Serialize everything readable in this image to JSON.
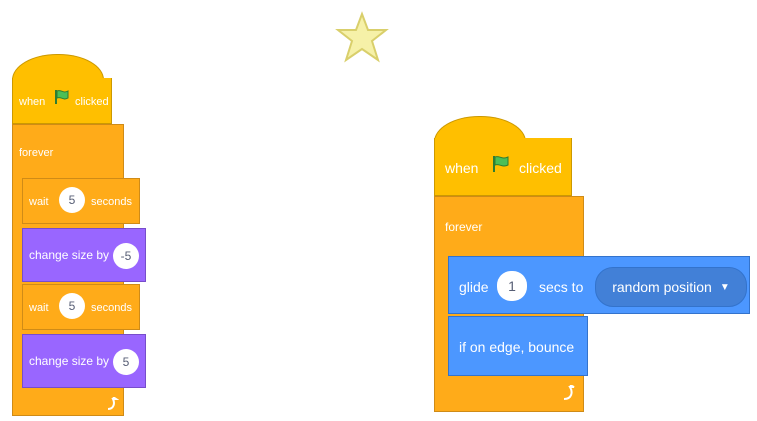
{
  "left_script": {
    "hat": {
      "prefix": "when",
      "suffix": "clicked"
    },
    "forever": "forever",
    "wait1": {
      "label": "wait",
      "value": "5",
      "unit": "seconds"
    },
    "change1": {
      "label": "change size by",
      "value": "-5"
    },
    "wait2": {
      "label": "wait",
      "value": "5",
      "unit": "seconds"
    },
    "change2": {
      "label": "change size by",
      "value": "5"
    }
  },
  "right_script": {
    "hat": {
      "prefix": "when",
      "suffix": "clicked"
    },
    "forever": "forever",
    "glide": {
      "label": "glide",
      "value": "1",
      "middle": "secs to",
      "dropdown": "random position"
    },
    "bounce": "if on edge, bounce"
  },
  "icons": {
    "flag": "green-flag-icon",
    "loop": "loop-arrow-icon",
    "sprite": "star-sprite-icon",
    "dropdown": "dropdown-caret-icon"
  },
  "colors": {
    "events": "#FFBF00",
    "control": "#FFAB19",
    "motion": "#4C97FF",
    "looks": "#9966FF"
  }
}
